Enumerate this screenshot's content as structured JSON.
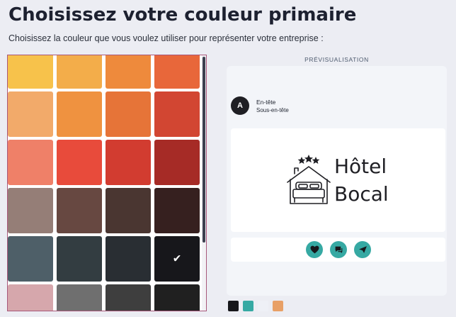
{
  "page": {
    "title": "Choisissez votre couleur primaire",
    "subtitle": "Choisissez la couleur que vous voulez utiliser pour représenter votre entreprise :"
  },
  "palette": {
    "rows": [
      [
        "#f7c24b",
        "#f3ad4a",
        "#ee8a3c",
        "#e8673a"
      ],
      [
        "#f2aa6a",
        "#ef9240",
        "#e67438",
        "#d24632"
      ],
      [
        "#ef8068",
        "#e84b3b",
        "#d23c30",
        "#a62b26"
      ],
      [
        "#957e77",
        "#674841",
        "#4a3631",
        "#36201f"
      ],
      [
        "#4e5f68",
        "#333d41",
        "#292e33",
        "#17171b"
      ],
      [
        "#d6a7ac",
        "#6f6f6f",
        "#3e3e3e",
        "#202020"
      ]
    ],
    "selected": {
      "row": 4,
      "col": 3
    },
    "check_glyph": "✔"
  },
  "preview": {
    "label": "PRÉVISUALISATION",
    "avatar_letter": "A",
    "header_title": "En-tête",
    "header_subtitle": "Sous-en-tête",
    "logo_line1": "Hôtel",
    "logo_line2": "Bocal",
    "actions": [
      {
        "icon": "heart-icon",
        "color": "#36a9a3"
      },
      {
        "icon": "chat-icon",
        "color": "#36a9a3"
      },
      {
        "icon": "send-icon",
        "color": "#36a9a3"
      }
    ]
  },
  "selected_colors": [
    "#17171b",
    "#36a9a3",
    "#eef0f6",
    "#e8a066"
  ]
}
